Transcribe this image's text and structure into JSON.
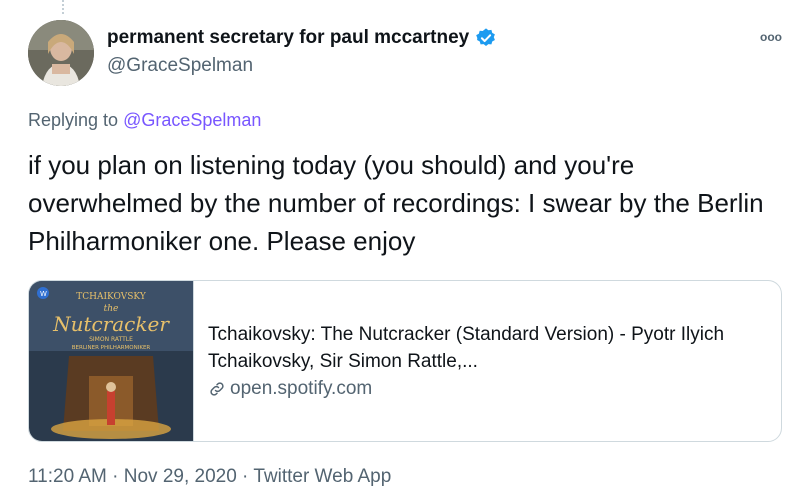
{
  "tweet": {
    "display_name": "permanent secretary for paul mccartney",
    "handle": "@GraceSpelman",
    "more_label": "ooo",
    "reply_prefix": "Replying to",
    "reply_handle": "@GraceSpelman",
    "text": "if you plan on listening today (you should) and you're overwhelmed by the number of recordings: I swear by the Berlin Philharmoniker one. Please enjoy",
    "timestamp": "11:20 AM · Nov 29, 2020 · Twitter Web App"
  },
  "card": {
    "title": "Tchaikovsky: The Nutcracker (Standard Version) - Pyotr Ilyich Tchaikovsky, Sir Simon Rattle,...",
    "domain": "open.spotify.com",
    "cover": {
      "line1": "TCHAIKOVSKY",
      "line2": "the",
      "line3": "Nutcracker",
      "line4": "SIMON RATTLE",
      "line5": "BERLINER PHILHARMONIKER"
    }
  },
  "colors": {
    "accent": "#7856ff",
    "verified": "#1d9bf0",
    "muted": "#536471",
    "border": "#cfd9de"
  }
}
